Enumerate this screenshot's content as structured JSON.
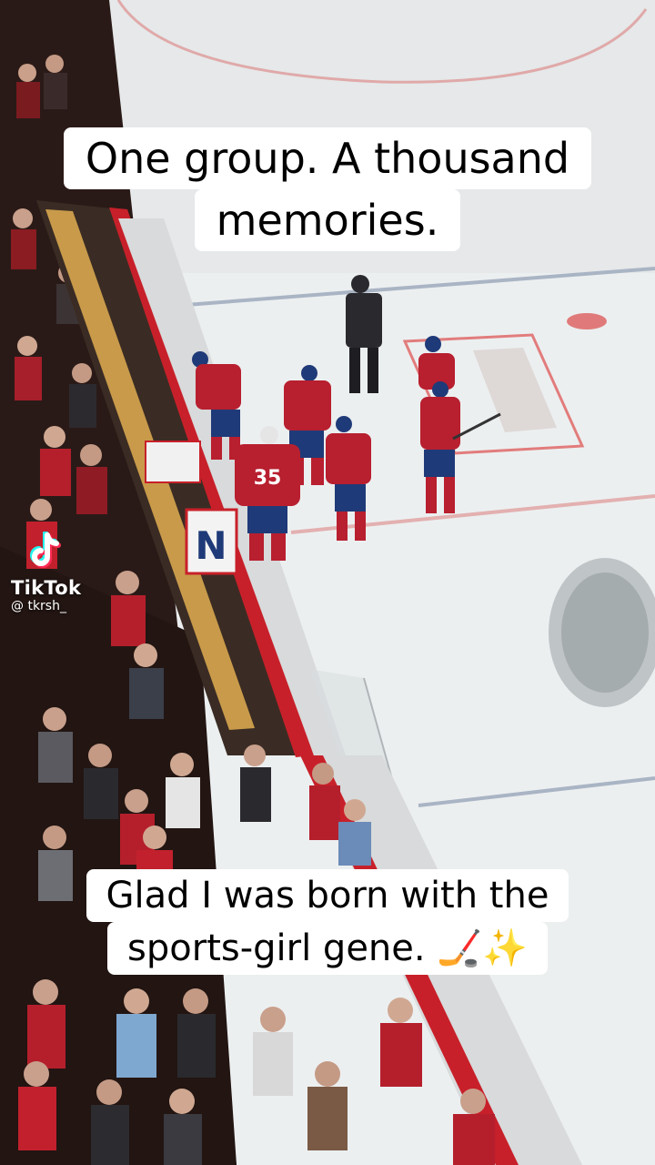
{
  "caption_top": {
    "line1": "One group. A thousand",
    "line2": "memories."
  },
  "caption_bottom": {
    "line1": "Glad I was born with the",
    "line2": "sports-girl gene. 🏒✨"
  },
  "watermark": {
    "brand": "TikTok",
    "handle": "@ tkrsh_"
  },
  "scene": {
    "jersey_number": "35",
    "board_letter": "N",
    "colors": {
      "ice": "#eef0f1",
      "board_red": "#c8202a",
      "jersey_red": "#b81f2f",
      "jersey_blue": "#1f3a78",
      "tiktok_cyan": "#25f4ee",
      "tiktok_pink": "#fe2c55"
    }
  }
}
